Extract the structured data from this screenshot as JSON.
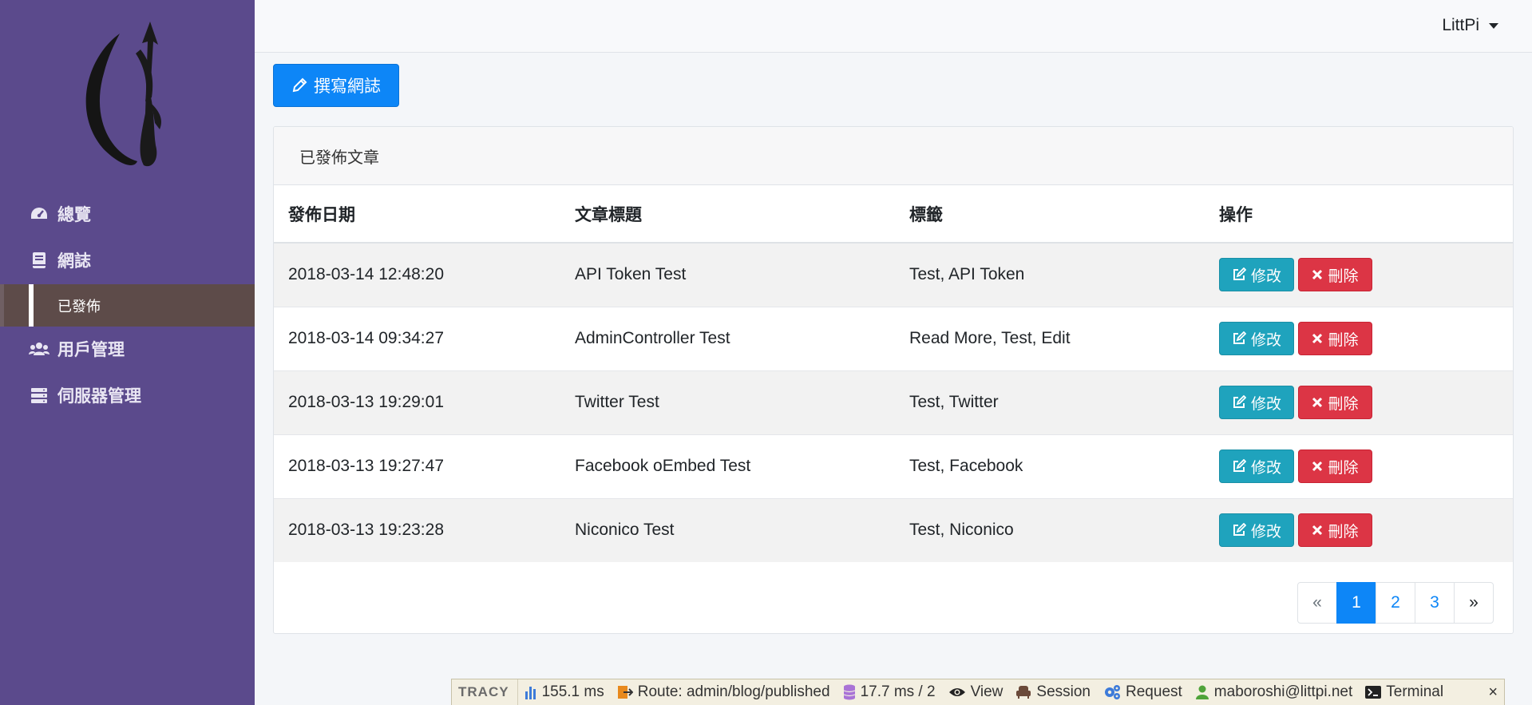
{
  "sidebar": {
    "items": [
      {
        "label": "總覽",
        "icon": "dashboard-icon"
      },
      {
        "label": "網誌",
        "icon": "book-icon"
      },
      {
        "label": "用戶管理",
        "icon": "users-icon"
      },
      {
        "label": "伺服器管理",
        "icon": "server-icon"
      }
    ],
    "sub_item": {
      "label": "已發佈"
    }
  },
  "header": {
    "user_name": "LittPi"
  },
  "write_button": {
    "label": "撰寫網誌",
    "icon": "pencil-icon"
  },
  "card": {
    "title": "已發佈文章",
    "columns": [
      "發佈日期",
      "文章標題",
      "標籤",
      "操作"
    ],
    "rows": [
      {
        "date": "2018-03-14 12:48:20",
        "title": "API Token Test",
        "tags": "Test, API Token"
      },
      {
        "date": "2018-03-14 09:34:27",
        "title": "AdminController Test",
        "tags": "Read More, Test, Edit"
      },
      {
        "date": "2018-03-13 19:29:01",
        "title": "Twitter Test",
        "tags": "Test, Twitter"
      },
      {
        "date": "2018-03-13 19:27:47",
        "title": "Facebook oEmbed Test",
        "tags": "Test, Facebook"
      },
      {
        "date": "2018-03-13 19:23:28",
        "title": "Niconico Test",
        "tags": "Test, Niconico"
      }
    ],
    "edit_label": "修改",
    "delete_label": "刪除"
  },
  "pagination": {
    "prev": "«",
    "pages": [
      "1",
      "2",
      "3"
    ],
    "next": "»",
    "active": "1"
  },
  "tracy": {
    "logo": "TRACY",
    "time": "155.1 ms",
    "route": "Route: admin/blog/published",
    "db": "17.7 ms / 2",
    "view": "View",
    "session": "Session",
    "request": "Request",
    "user": "maboroshi@littpi.net",
    "terminal": "Terminal",
    "close": "×"
  },
  "colors": {
    "sidebar": "#5b4a8c",
    "primary": "#0d86f7",
    "info": "#1fa3bd",
    "danger": "#dc3545",
    "active_nav": "#5d4b49"
  }
}
